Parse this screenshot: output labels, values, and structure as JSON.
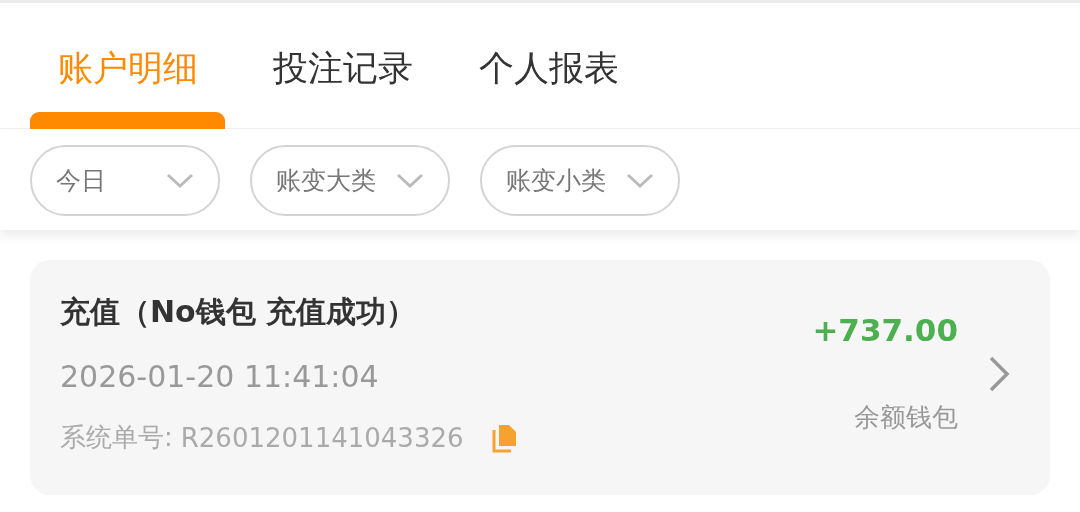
{
  "tabs": [
    {
      "label": "账户明细",
      "selected": true
    },
    {
      "label": "投注记录",
      "selected": false
    },
    {
      "label": "个人报表",
      "selected": false
    }
  ],
  "filters": [
    {
      "label": "今日"
    },
    {
      "label": "账变大类"
    },
    {
      "label": "账变小类"
    }
  ],
  "records": [
    {
      "title": "充值（No钱包 充值成功）",
      "time": "2026-01-20 11:41:04",
      "order_label": "系统单号:",
      "order_no": "R2601201141043326",
      "amount": "+737.00",
      "wallet": "余额钱包"
    }
  ]
}
